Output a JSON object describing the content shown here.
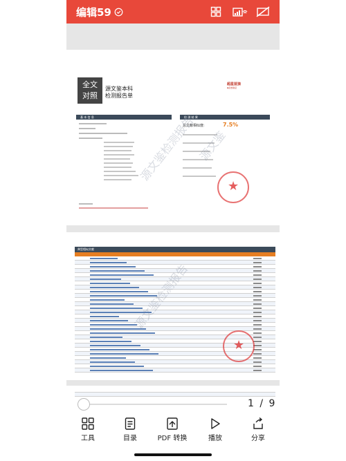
{
  "toolbar": {
    "title": "编辑59",
    "accent": "#e8483a",
    "icons": [
      "cloud-check-icon",
      "grid-icon",
      "wifi-screen-icon",
      "no-screen-icon"
    ]
  },
  "page1": {
    "logo_line1": "全文",
    "logo_line2": "对照",
    "title_line1": "源文鉴本科",
    "title_line2": "检测报告单",
    "brand": "超星蓝狼",
    "brand_sub": "▪点击验证",
    "basic_info_header": "基 本 信 息",
    "result_header": "检 测 结 果",
    "total_similarity_label": "总文献相似度:",
    "total_similarity_value": "7.5%",
    "watermark": "源文鉴检测报告",
    "watermark2": "源文鉴"
  },
  "page2": {
    "table_title": "典型相似文献",
    "watermark": "源文鉴检测报告"
  },
  "viewer": {
    "current_page": "1",
    "total_pages": "9",
    "separator": "/",
    "progress": 0.11
  },
  "tools": [
    {
      "label": "工具",
      "icon": "tools-grid-icon"
    },
    {
      "label": "目录",
      "icon": "document-list-icon"
    },
    {
      "label": "PDF 转换",
      "icon": "pdf-convert-icon"
    },
    {
      "label": "播放",
      "icon": "play-icon"
    },
    {
      "label": "分享",
      "icon": "share-icon"
    }
  ]
}
